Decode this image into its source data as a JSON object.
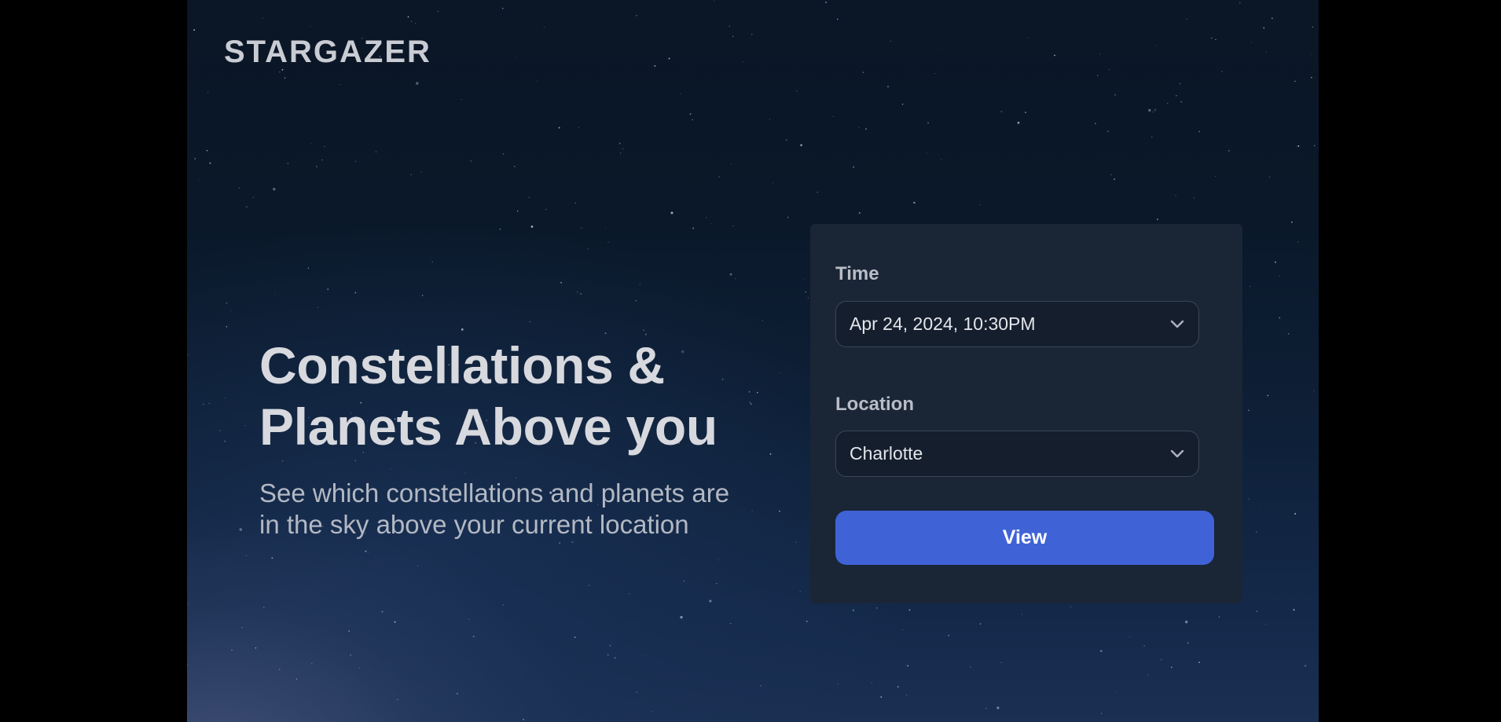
{
  "brand": {
    "logo": "STARGAZER"
  },
  "hero": {
    "title_line1": "Constellations &",
    "title_line2": "Planets Above you",
    "subtitle_line1": "See which constellations and planets are",
    "subtitle_line2": "in the sky above your current location"
  },
  "form": {
    "time": {
      "label": "Time",
      "value": "Apr 24, 2024, 10:30PM",
      "icon": "chevron-down-icon"
    },
    "location": {
      "label": "Location",
      "value": "Charlotte",
      "icon": "chevron-down-icon"
    },
    "submit_label": "View"
  },
  "colors": {
    "background_top": "#0b1626",
    "background_bottom": "#1a2f52",
    "panel": "#1a2536",
    "select": "#151e2d",
    "accent": "#3f63d6",
    "text_primary": "#d7d9de",
    "text_secondary": "#b3b8c3"
  }
}
